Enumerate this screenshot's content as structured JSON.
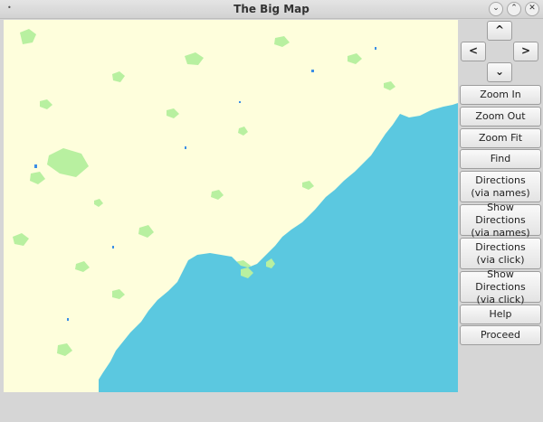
{
  "window": {
    "title": "The Big Map",
    "controls": {
      "minimize": "⌄",
      "maximize": "⌃",
      "close": "✕"
    },
    "menu_glyph": "•"
  },
  "map": {
    "colors": {
      "land": "#fefedc",
      "water": "#5bc8e0",
      "parks": "#b8f0a0",
      "lakes": "#3b8ee6"
    }
  },
  "navigation": {
    "up": "^",
    "left": "<",
    "right": ">",
    "down": "⌄"
  },
  "buttons": {
    "zoom_in": "Zoom In",
    "zoom_out": "Zoom Out",
    "zoom_fit": "Zoom Fit",
    "find": "Find",
    "directions_names": {
      "line1": "Directions",
      "line2": "(via names)"
    },
    "show_directions_names": {
      "line1": "Show Directions",
      "line2": "(via names)"
    },
    "directions_click": {
      "line1": "Directions",
      "line2": "(via click)"
    },
    "show_directions_click": {
      "line1": "Show Directions",
      "line2": "(via click)"
    },
    "help": "Help",
    "proceed": "Proceed"
  }
}
